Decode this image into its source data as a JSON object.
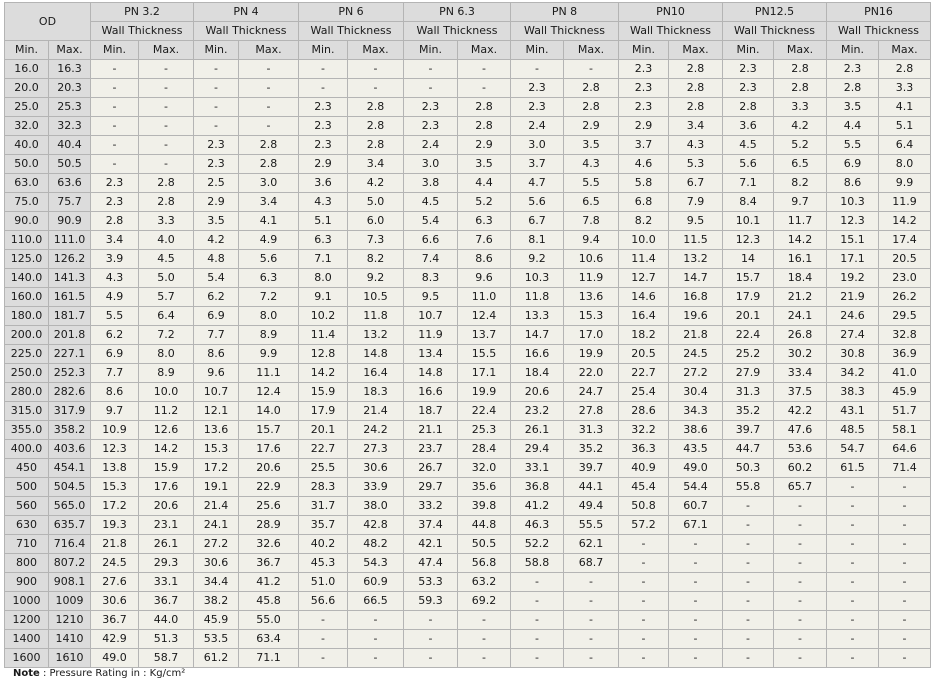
{
  "table": {
    "od_header": "OD",
    "sub_header": "Wall Thickness",
    "min_label": "Min.",
    "max_label": "Max.",
    "pressure_classes": [
      "PN 3.2",
      "PN 4",
      "PN 6",
      "PN 6.3",
      "PN 8",
      "PN10",
      "PN12.5",
      "PN16"
    ],
    "rows": [
      {
        "od_min": "16.0",
        "od_max": "16.3",
        "values": [
          "-",
          "-",
          "-",
          "-",
          "-",
          "-",
          "-",
          "-",
          "-",
          "-",
          "2.3",
          "2.8",
          "2.3",
          "2.8",
          "2.3",
          "2.8"
        ]
      },
      {
        "od_min": "20.0",
        "od_max": "20.3",
        "values": [
          "-",
          "-",
          "-",
          "-",
          "-",
          "-",
          "-",
          "-",
          "2.3",
          "2.8",
          "2.3",
          "2.8",
          "2.3",
          "2.8",
          "2.8",
          "3.3"
        ]
      },
      {
        "od_min": "25.0",
        "od_max": "25.3",
        "values": [
          "-",
          "-",
          "-",
          "-",
          "2.3",
          "2.8",
          "2.3",
          "2.8",
          "2.3",
          "2.8",
          "2.3",
          "2.8",
          "2.8",
          "3.3",
          "3.5",
          "4.1"
        ]
      },
      {
        "od_min": "32.0",
        "od_max": "32.3",
        "values": [
          "-",
          "-",
          "-",
          "-",
          "2.3",
          "2.8",
          "2.3",
          "2.8",
          "2.4",
          "2.9",
          "2.9",
          "3.4",
          "3.6",
          "4.2",
          "4.4",
          "5.1"
        ]
      },
      {
        "od_min": "40.0",
        "od_max": "40.4",
        "values": [
          "-",
          "-",
          "2.3",
          "2.8",
          "2.3",
          "2.8",
          "2.4",
          "2.9",
          "3.0",
          "3.5",
          "3.7",
          "4.3",
          "4.5",
          "5.2",
          "5.5",
          "6.4"
        ]
      },
      {
        "od_min": "50.0",
        "od_max": "50.5",
        "values": [
          "-",
          "-",
          "2.3",
          "2.8",
          "2.9",
          "3.4",
          "3.0",
          "3.5",
          "3.7",
          "4.3",
          "4.6",
          "5.3",
          "5.6",
          "6.5",
          "6.9",
          "8.0"
        ]
      },
      {
        "od_min": "63.0",
        "od_max": "63.6",
        "values": [
          "2.3",
          "2.8",
          "2.5",
          "3.0",
          "3.6",
          "4.2",
          "3.8",
          "4.4",
          "4.7",
          "5.5",
          "5.8",
          "6.7",
          "7.1",
          "8.2",
          "8.6",
          "9.9"
        ]
      },
      {
        "od_min": "75.0",
        "od_max": "75.7",
        "values": [
          "2.3",
          "2.8",
          "2.9",
          "3.4",
          "4.3",
          "5.0",
          "4.5",
          "5.2",
          "5.6",
          "6.5",
          "6.8",
          "7.9",
          "8.4",
          "9.7",
          "10.3",
          "11.9"
        ]
      },
      {
        "od_min": "90.0",
        "od_max": "90.9",
        "values": [
          "2.8",
          "3.3",
          "3.5",
          "4.1",
          "5.1",
          "6.0",
          "5.4",
          "6.3",
          "6.7",
          "7.8",
          "8.2",
          "9.5",
          "10.1",
          "11.7",
          "12.3",
          "14.2"
        ]
      },
      {
        "od_min": "110.0",
        "od_max": "111.0",
        "values": [
          "3.4",
          "4.0",
          "4.2",
          "4.9",
          "6.3",
          "7.3",
          "6.6",
          "7.6",
          "8.1",
          "9.4",
          "10.0",
          "11.5",
          "12.3",
          "14.2",
          "15.1",
          "17.4"
        ]
      },
      {
        "od_min": "125.0",
        "od_max": "126.2",
        "values": [
          "3.9",
          "4.5",
          "4.8",
          "5.6",
          "7.1",
          "8.2",
          "7.4",
          "8.6",
          "9.2",
          "10.6",
          "11.4",
          "13.2",
          "14",
          "16.1",
          "17.1",
          "20.5"
        ]
      },
      {
        "od_min": "140.0",
        "od_max": "141.3",
        "values": [
          "4.3",
          "5.0",
          "5.4",
          "6.3",
          "8.0",
          "9.2",
          "8.3",
          "9.6",
          "10.3",
          "11.9",
          "12.7",
          "14.7",
          "15.7",
          "18.4",
          "19.2",
          "23.0"
        ]
      },
      {
        "od_min": "160.0",
        "od_max": "161.5",
        "values": [
          "4.9",
          "5.7",
          "6.2",
          "7.2",
          "9.1",
          "10.5",
          "9.5",
          "11.0",
          "11.8",
          "13.6",
          "14.6",
          "16.8",
          "17.9",
          "21.2",
          "21.9",
          "26.2"
        ]
      },
      {
        "od_min": "180.0",
        "od_max": "181.7",
        "values": [
          "5.5",
          "6.4",
          "6.9",
          "8.0",
          "10.2",
          "11.8",
          "10.7",
          "12.4",
          "13.3",
          "15.3",
          "16.4",
          "19.6",
          "20.1",
          "24.1",
          "24.6",
          "29.5"
        ]
      },
      {
        "od_min": "200.0",
        "od_max": "201.8",
        "values": [
          "6.2",
          "7.2",
          "7.7",
          "8.9",
          "11.4",
          "13.2",
          "11.9",
          "13.7",
          "14.7",
          "17.0",
          "18.2",
          "21.8",
          "22.4",
          "26.8",
          "27.4",
          "32.8"
        ]
      },
      {
        "od_min": "225.0",
        "od_max": "227.1",
        "values": [
          "6.9",
          "8.0",
          "8.6",
          "9.9",
          "12.8",
          "14.8",
          "13.4",
          "15.5",
          "16.6",
          "19.9",
          "20.5",
          "24.5",
          "25.2",
          "30.2",
          "30.8",
          "36.9"
        ]
      },
      {
        "od_min": "250.0",
        "od_max": "252.3",
        "values": [
          "7.7",
          "8.9",
          "9.6",
          "11.1",
          "14.2",
          "16.4",
          "14.8",
          "17.1",
          "18.4",
          "22.0",
          "22.7",
          "27.2",
          "27.9",
          "33.4",
          "34.2",
          "41.0"
        ]
      },
      {
        "od_min": "280.0",
        "od_max": "282.6",
        "values": [
          "8.6",
          "10.0",
          "10.7",
          "12.4",
          "15.9",
          "18.3",
          "16.6",
          "19.9",
          "20.6",
          "24.7",
          "25.4",
          "30.4",
          "31.3",
          "37.5",
          "38.3",
          "45.9"
        ]
      },
      {
        "od_min": "315.0",
        "od_max": "317.9",
        "values": [
          "9.7",
          "11.2",
          "12.1",
          "14.0",
          "17.9",
          "21.4",
          "18.7",
          "22.4",
          "23.2",
          "27.8",
          "28.6",
          "34.3",
          "35.2",
          "42.2",
          "43.1",
          "51.7"
        ]
      },
      {
        "od_min": "355.0",
        "od_max": "358.2",
        "values": [
          "10.9",
          "12.6",
          "13.6",
          "15.7",
          "20.1",
          "24.2",
          "21.1",
          "25.3",
          "26.1",
          "31.3",
          "32.2",
          "38.6",
          "39.7",
          "47.6",
          "48.5",
          "58.1"
        ]
      },
      {
        "od_min": "400.0",
        "od_max": "403.6",
        "values": [
          "12.3",
          "14.2",
          "15.3",
          "17.6",
          "22.7",
          "27.3",
          "23.7",
          "28.4",
          "29.4",
          "35.2",
          "36.3",
          "43.5",
          "44.7",
          "53.6",
          "54.7",
          "64.6"
        ]
      },
      {
        "od_min": "450",
        "od_max": "454.1",
        "values": [
          "13.8",
          "15.9",
          "17.2",
          "20.6",
          "25.5",
          "30.6",
          "26.7",
          "32.0",
          "33.1",
          "39.7",
          "40.9",
          "49.0",
          "50.3",
          "60.2",
          "61.5",
          "71.4"
        ]
      },
      {
        "od_min": "500",
        "od_max": "504.5",
        "values": [
          "15.3",
          "17.6",
          "19.1",
          "22.9",
          "28.3",
          "33.9",
          "29.7",
          "35.6",
          "36.8",
          "44.1",
          "45.4",
          "54.4",
          "55.8",
          "65.7",
          "-",
          "-"
        ]
      },
      {
        "od_min": "560",
        "od_max": "565.0",
        "values": [
          "17.2",
          "20.6",
          "21.4",
          "25.6",
          "31.7",
          "38.0",
          "33.2",
          "39.8",
          "41.2",
          "49.4",
          "50.8",
          "60.7",
          "-",
          "-",
          "-",
          "-"
        ]
      },
      {
        "od_min": "630",
        "od_max": "635.7",
        "values": [
          "19.3",
          "23.1",
          "24.1",
          "28.9",
          "35.7",
          "42.8",
          "37.4",
          "44.8",
          "46.3",
          "55.5",
          "57.2",
          "67.1",
          "-",
          "-",
          "-",
          "-"
        ]
      },
      {
        "od_min": "710",
        "od_max": "716.4",
        "values": [
          "21.8",
          "26.1",
          "27.2",
          "32.6",
          "40.2",
          "48.2",
          "42.1",
          "50.5",
          "52.2",
          "62.1",
          "-",
          "-",
          "-",
          "-",
          "-",
          "-"
        ]
      },
      {
        "od_min": "800",
        "od_max": "807.2",
        "values": [
          "24.5",
          "29.3",
          "30.6",
          "36.7",
          "45.3",
          "54.3",
          "47.4",
          "56.8",
          "58.8",
          "68.7",
          "-",
          "-",
          "-",
          "-",
          "-",
          "-"
        ]
      },
      {
        "od_min": "900",
        "od_max": "908.1",
        "values": [
          "27.6",
          "33.1",
          "34.4",
          "41.2",
          "51.0",
          "60.9",
          "53.3",
          "63.2",
          "-",
          "-",
          "-",
          "-",
          "-",
          "-",
          "-",
          "-"
        ]
      },
      {
        "od_min": "1000",
        "od_max": "1009",
        "values": [
          "30.6",
          "36.7",
          "38.2",
          "45.8",
          "56.6",
          "66.5",
          "59.3",
          "69.2",
          "-",
          "-",
          "-",
          "-",
          "-",
          "-",
          "-",
          "-"
        ]
      },
      {
        "od_min": "1200",
        "od_max": "1210",
        "values": [
          "36.7",
          "44.0",
          "45.9",
          "55.0",
          "-",
          "-",
          "-",
          "-",
          "-",
          "-",
          "-",
          "-",
          "-",
          "-",
          "-",
          "-"
        ]
      },
      {
        "od_min": "1400",
        "od_max": "1410",
        "values": [
          "42.9",
          "51.3",
          "53.5",
          "63.4",
          "-",
          "-",
          "-",
          "-",
          "-",
          "-",
          "-",
          "-",
          "-",
          "-",
          "-",
          "-"
        ]
      },
      {
        "od_min": "1600",
        "od_max": "1610",
        "values": [
          "49.0",
          "58.7",
          "61.2",
          "71.1",
          "-",
          "-",
          "-",
          "-",
          "-",
          "-",
          "-",
          "-",
          "-",
          "-",
          "-",
          "-"
        ]
      }
    ]
  },
  "note": {
    "label": "Note",
    "text": " : Pressure Rating in : Kg/cm²"
  }
}
